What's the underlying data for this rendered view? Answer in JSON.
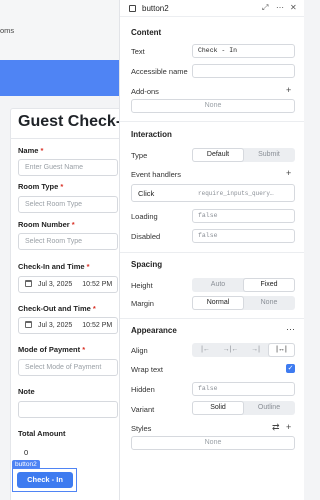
{
  "canvas": {
    "breadcrumb": "oms",
    "form_title": "Guest Check-In",
    "fields": [
      {
        "label": "Name",
        "required": true,
        "placeholder": "Enter Guest Name"
      },
      {
        "label": "Room Type",
        "required": true,
        "placeholder": "Select Room Type"
      },
      {
        "label": "Room Number",
        "required": true,
        "placeholder": "Select Room Type"
      },
      {
        "label": "Check-In and Time",
        "required": true,
        "date": "Jul 3, 2025",
        "time": "10:52 PM"
      },
      {
        "label": "Check-Out and Time",
        "required": true,
        "date": "Jul 3, 2025",
        "time": "10:52 PM"
      },
      {
        "label": "Mode of Payment",
        "required": true,
        "placeholder": "Select Mode of Payment"
      },
      {
        "label": "Note",
        "required": false,
        "placeholder": ""
      },
      {
        "label": "Total Amount",
        "required": false,
        "value": "0"
      }
    ],
    "selected_tag": "button2",
    "button_label": "Check - In"
  },
  "panel": {
    "component_name": "button2",
    "header_icons": [
      "expand-icon",
      "more-icon",
      "close-icon"
    ],
    "content": {
      "title": "Content",
      "text_label": "Text",
      "text_value": "Check - In",
      "accessible_name_label": "Accessible name",
      "accessible_name_value": "",
      "addons_label": "Add-ons",
      "addons_value": "None"
    },
    "interaction": {
      "title": "Interaction",
      "type_label": "Type",
      "type_options": [
        "Default",
        "Submit"
      ],
      "type_selected": "Default",
      "event_handlers_label": "Event handlers",
      "handler_event": "Click",
      "handler_action": "require_inputs_query…",
      "loading_label": "Loading",
      "loading_value": "false",
      "disabled_label": "Disabled",
      "disabled_value": "false"
    },
    "spacing": {
      "title": "Spacing",
      "height_label": "Height",
      "height_options": [
        "Auto",
        "Fixed"
      ],
      "height_selected": "Fixed",
      "margin_label": "Margin",
      "margin_options": [
        "Normal",
        "None"
      ],
      "margin_selected": "Normal"
    },
    "appearance": {
      "title": "Appearance",
      "align_label": "Align",
      "align_options": [
        "align-left",
        "align-center",
        "align-right",
        "align-stretch"
      ],
      "align_selected": "align-stretch",
      "wrap_label": "Wrap text",
      "wrap_checked": true,
      "hidden_label": "Hidden",
      "hidden_value": "false",
      "variant_label": "Variant",
      "variant_options": [
        "Solid",
        "Outline"
      ],
      "variant_selected": "Solid",
      "styles_label": "Styles",
      "styles_value": "None"
    },
    "accent_color": "#3e7bf0"
  }
}
